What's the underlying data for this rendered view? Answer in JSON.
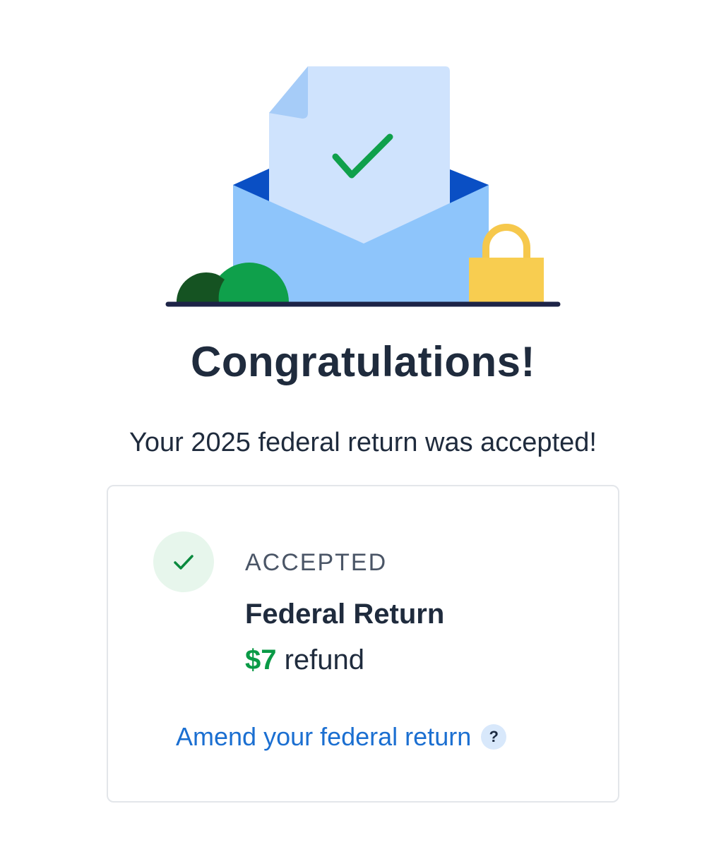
{
  "header": {
    "title": "Congratulations!",
    "subtitle": "Your 2025 federal return was accepted!"
  },
  "status_card": {
    "status": "ACCEPTED",
    "return_name": "Federal Return",
    "refund_amount": "$7",
    "refund_text": " refund",
    "amend_link": "Amend your federal return",
    "help_symbol": "?"
  },
  "icons": {
    "hero": "accepted-return-envelope-illustration",
    "status": "checkmark-icon",
    "help": "question-mark-icon"
  },
  "colors": {
    "accent_blue": "#1b6fd1",
    "success_green": "#0a9a46",
    "status_circle_bg": "#e7f6ec",
    "text_dark": "#1f2b3d"
  }
}
